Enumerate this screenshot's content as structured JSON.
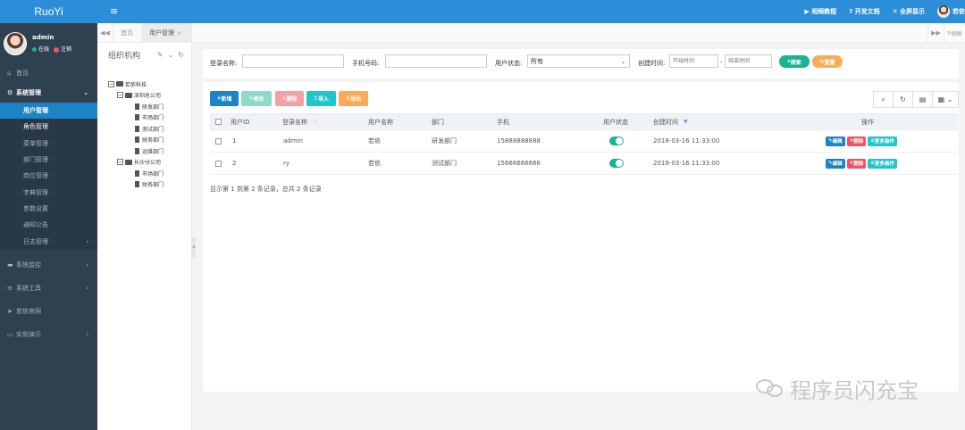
{
  "brand": "RuoYi",
  "user": {
    "name": "admin",
    "status": "在线",
    "logout": "注销"
  },
  "sidebar": {
    "home": "首页",
    "system": "系统管理",
    "system_items": [
      "用户管理",
      "角色管理",
      "菜单管理",
      "部门管理",
      "岗位管理",
      "字典管理",
      "参数设置",
      "通知公告",
      "日志管理"
    ],
    "monitor": "系统监控",
    "tools": "系统工具",
    "ruoyi": "若依官网",
    "demo": "实例演示"
  },
  "topbar": {
    "video": "视频教程",
    "docs": "开发文档",
    "fullscreen": "全屏显示",
    "username": "若依"
  },
  "tabs": {
    "home": "首页",
    "active": "用户管理",
    "refresh": "刷新"
  },
  "tree": {
    "title": "组织机构",
    "root": "若依科技",
    "branch1": "深圳总公司",
    "branch1_children": [
      "研发部门",
      "市场部门",
      "测试部门",
      "财务部门",
      "运维部门"
    ],
    "branch2": "长沙分公司",
    "branch2_children": [
      "市场部门",
      "财务部门"
    ]
  },
  "search": {
    "login_label": "登录名称:",
    "phone_label": "手机号码:",
    "status_label": "用户状态:",
    "status_value": "所有",
    "time_label": "创建时间:",
    "start_placeholder": "开始时间",
    "end_placeholder": "结束时间",
    "dash": "-",
    "search_btn": "搜索",
    "reset_btn": "重置"
  },
  "toolbar": {
    "add": "新增",
    "edit": "修改",
    "delete": "删除",
    "import": "导入",
    "export": "导出"
  },
  "table": {
    "headers": {
      "id": "用户ID",
      "login": "登录名称",
      "name": "用户名称",
      "dept": "部门",
      "phone": "手机",
      "status": "用户状态",
      "created": "创建时间",
      "ops": "操作"
    },
    "rows": [
      {
        "id": "1",
        "login": "admin",
        "name": "若依",
        "dept": "研发部门",
        "phone": "15888888888",
        "created": "2018-03-16 11:33:00"
      },
      {
        "id": "2",
        "login": "ry",
        "name": "若依",
        "dept": "测试部门",
        "phone": "15666666666",
        "created": "2018-03-16 11:33:00"
      }
    ],
    "row_actions": {
      "edit": "编辑",
      "delete": "删除",
      "more": "更多操作"
    }
  },
  "pagination": "显示第 1 到第 2 条记录，总共 2 条记录",
  "watermark": "程序员闪充宝",
  "colors": {
    "topbar": "#2c8ed8",
    "sidebar": "#2f4050",
    "active": "#1c84c6",
    "success": "#1ab394",
    "danger": "#ed5565",
    "warning": "#f8ac59",
    "info": "#23c6c8"
  }
}
